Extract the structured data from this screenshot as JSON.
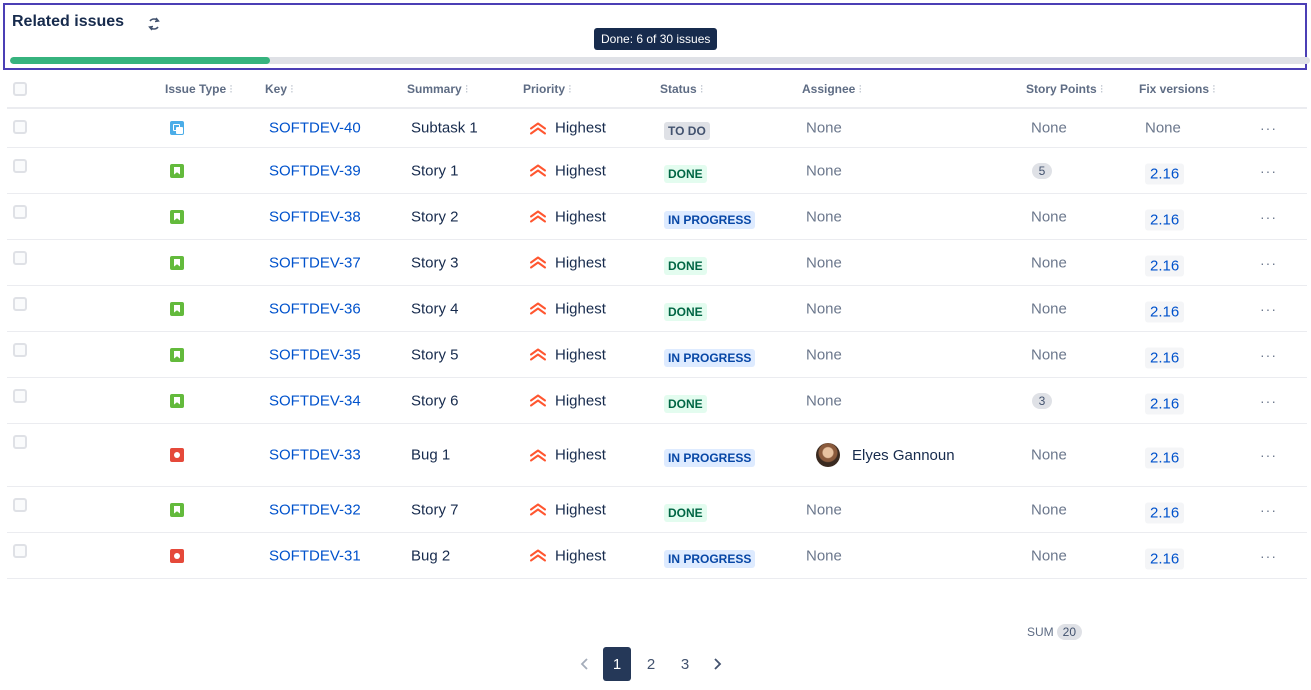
{
  "header": {
    "title": "Related issues",
    "tooltip": "Done: 6 of 30 issues",
    "progress_fraction": 0.2
  },
  "columns": {
    "issue_type": "Issue Type",
    "key": "Key",
    "summary": "Summary",
    "priority": "Priority",
    "status": "Status",
    "assignee": "Assignee",
    "story_points": "Story Points",
    "fix_versions": "Fix versions"
  },
  "rows": [
    {
      "type": "subtask",
      "key": "SOFTDEV-40",
      "summary": "Subtask 1",
      "priority": "Highest",
      "status": "TO DO",
      "status_kind": "todo",
      "assignee": "None",
      "points": "None",
      "fix": "None"
    },
    {
      "type": "story",
      "key": "SOFTDEV-39",
      "summary": "Story 1",
      "priority": "Highest",
      "status": "DONE",
      "status_kind": "done",
      "assignee": "None",
      "points": "5",
      "fix": "2.16"
    },
    {
      "type": "story",
      "key": "SOFTDEV-38",
      "summary": "Story 2",
      "priority": "Highest",
      "status": "IN PROGRESS",
      "status_kind": "inprogress",
      "assignee": "None",
      "points": "None",
      "fix": "2.16"
    },
    {
      "type": "story",
      "key": "SOFTDEV-37",
      "summary": "Story 3",
      "priority": "Highest",
      "status": "DONE",
      "status_kind": "done",
      "assignee": "None",
      "points": "None",
      "fix": "2.16"
    },
    {
      "type": "story",
      "key": "SOFTDEV-36",
      "summary": "Story 4",
      "priority": "Highest",
      "status": "DONE",
      "status_kind": "done",
      "assignee": "None",
      "points": "None",
      "fix": "2.16"
    },
    {
      "type": "story",
      "key": "SOFTDEV-35",
      "summary": "Story 5",
      "priority": "Highest",
      "status": "IN PROGRESS",
      "status_kind": "inprogress",
      "assignee": "None",
      "points": "None",
      "fix": "2.16"
    },
    {
      "type": "story",
      "key": "SOFTDEV-34",
      "summary": "Story 6",
      "priority": "Highest",
      "status": "DONE",
      "status_kind": "done",
      "assignee": "None",
      "points": "3",
      "fix": "2.16"
    },
    {
      "type": "bug",
      "key": "SOFTDEV-33",
      "summary": "Bug 1",
      "priority": "Highest",
      "status": "IN PROGRESS",
      "status_kind": "inprogress",
      "assignee": "Elyes Gannoun",
      "points": "None",
      "fix": "2.16"
    },
    {
      "type": "story",
      "key": "SOFTDEV-32",
      "summary": "Story 7",
      "priority": "Highest",
      "status": "DONE",
      "status_kind": "done",
      "assignee": "None",
      "points": "None",
      "fix": "2.16"
    },
    {
      "type": "bug",
      "key": "SOFTDEV-31",
      "summary": "Bug 2",
      "priority": "Highest",
      "status": "IN PROGRESS",
      "status_kind": "inprogress",
      "assignee": "None",
      "points": "None",
      "fix": "2.16"
    }
  ],
  "footer": {
    "sum_label": "SUM",
    "sum_value": "20"
  },
  "pagination": {
    "pages": [
      "1",
      "2",
      "3"
    ],
    "current": "1"
  },
  "colors": {
    "accent": "#0052cc",
    "progress": "#36b37e",
    "priority_highest": "#ff5630",
    "header_border": "#4b3fb5"
  }
}
